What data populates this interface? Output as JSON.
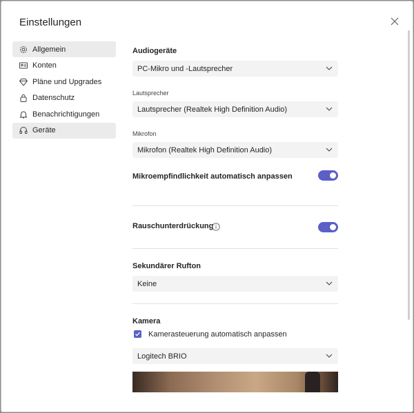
{
  "dialog": {
    "title": "Einstellungen"
  },
  "nav": {
    "items": [
      {
        "label": "Allgemein",
        "icon": "gear-icon",
        "active": true
      },
      {
        "label": "Konten",
        "icon": "id-card-icon",
        "active": false
      },
      {
        "label": "Pläne und Upgrades",
        "icon": "diamond-icon",
        "active": false
      },
      {
        "label": "Datenschutz",
        "icon": "lock-icon",
        "active": false
      },
      {
        "label": "Benachrichtigungen",
        "icon": "bell-icon",
        "active": false
      },
      {
        "label": "Geräte",
        "icon": "headset-icon",
        "active": true
      }
    ]
  },
  "audio": {
    "heading": "Audiogeräte",
    "device_value": "PC-Mikro und -Lautsprecher",
    "speaker_label": "Lautsprecher",
    "speaker_value": "Lautsprecher (Realtek High Definition Audio)",
    "mic_label": "Mikrofon",
    "mic_value": "Mikrofon (Realtek High Definition Audio)",
    "auto_mic_label": "Mikroempfindlichkeit automatisch anpassen",
    "auto_mic_on": true
  },
  "noise": {
    "label": "Rauschunterdrückung",
    "on": true
  },
  "ringer": {
    "heading": "Sekundärer Rufton",
    "value": "Keine"
  },
  "camera": {
    "heading": "Kamera",
    "auto_adjust_label": "Kamerasteuerung automatisch anpassen",
    "auto_adjust_checked": true,
    "device_value": "Logitech BRIO"
  },
  "colors": {
    "accent": "#5b5fc7",
    "active_nav_bg": "#ebebeb",
    "select_bg": "#f3f3f3"
  }
}
